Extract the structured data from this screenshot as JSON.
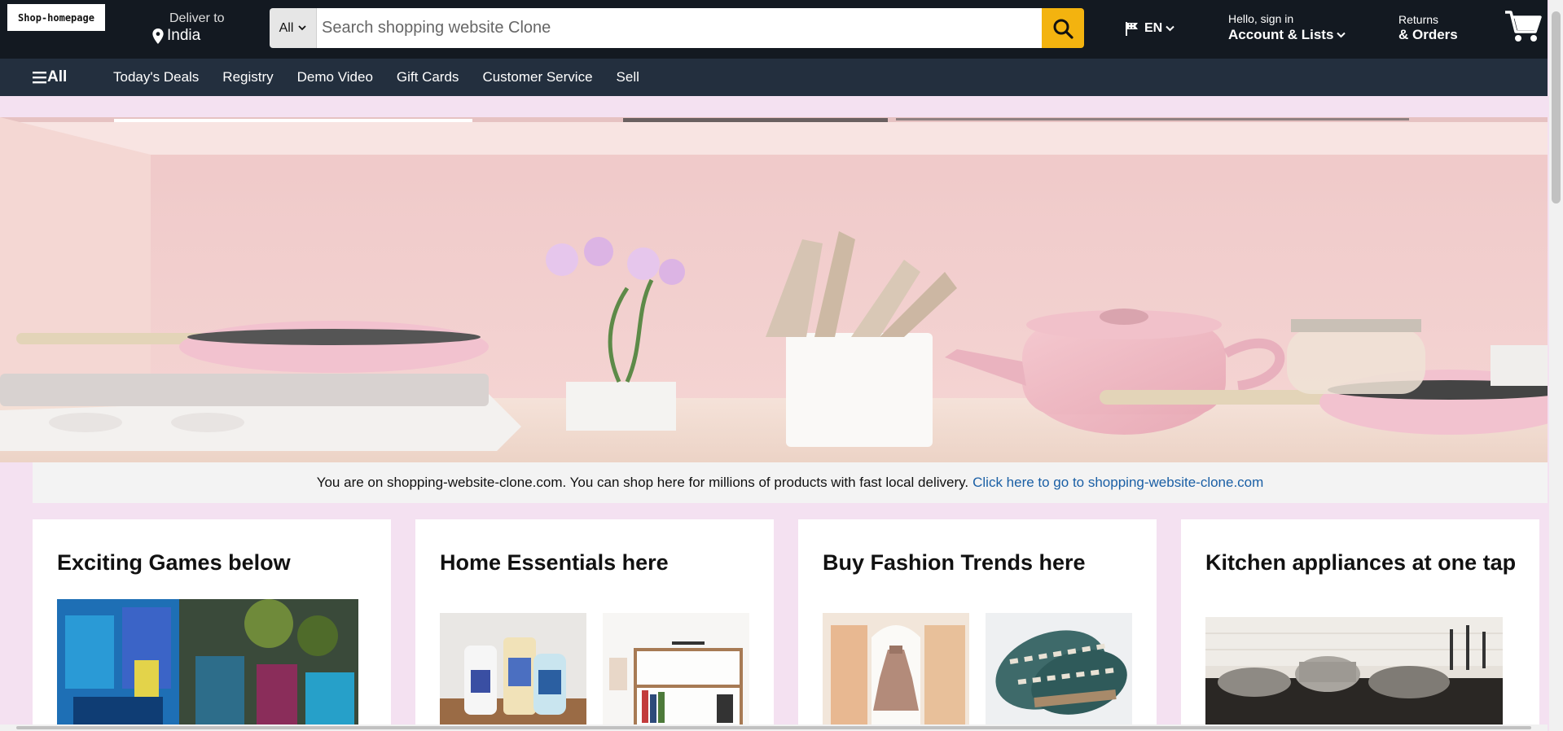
{
  "header": {
    "logo_text": "Shop-homepage",
    "deliver_label": "Deliver to",
    "deliver_location": "India",
    "search_category": "All",
    "search_placeholder": "Search shopping website Clone",
    "language": "EN",
    "account_greeting": "Hello, sign in",
    "account_label": "Account & Lists",
    "returns_label": "Returns",
    "orders_label": "& Orders"
  },
  "subnav": {
    "all_label": "All",
    "items": [
      "Today's Deals",
      "Registry",
      "Demo Video",
      "Gift Cards",
      "Customer Service",
      "Sell"
    ]
  },
  "notice": {
    "text": "You are on shopping-website-clone.com. You can shop here for millions of products with fast local delivery.",
    "link": "Click here to go to shopping-website-clone.com"
  },
  "cards": [
    {
      "title": "Exciting Games below"
    },
    {
      "title": "Home Essentials here"
    },
    {
      "title": "Buy Fashion Trends here"
    },
    {
      "title": "Kitchen appliances at one tap"
    }
  ],
  "colors": {
    "header_bg": "#131921",
    "subnav_bg": "#232f3e",
    "search_button": "#f3b30f",
    "page_bg": "#f4e1f1",
    "link": "#1a5fa5"
  }
}
